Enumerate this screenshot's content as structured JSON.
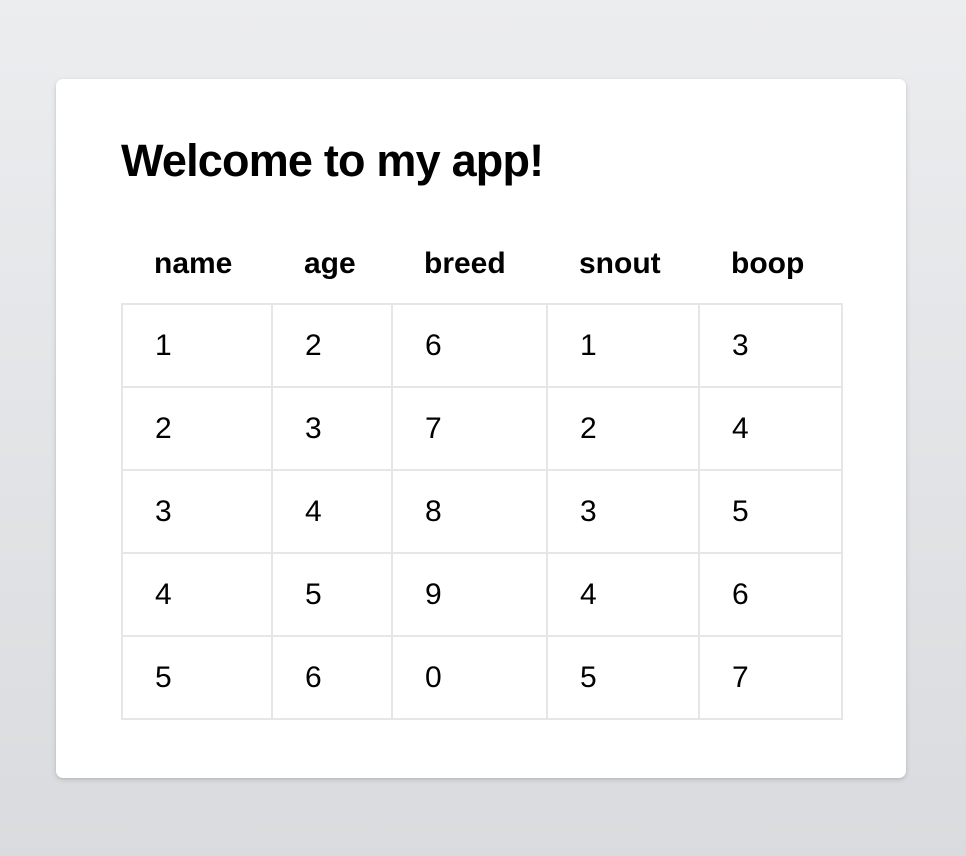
{
  "page": {
    "title": "Welcome to my app!"
  },
  "table": {
    "columns": [
      "name",
      "age",
      "breed",
      "snout",
      "boop"
    ],
    "rows": [
      [
        "1",
        "2",
        "6",
        "1",
        "3"
      ],
      [
        "2",
        "3",
        "7",
        "2",
        "4"
      ],
      [
        "3",
        "4",
        "8",
        "3",
        "5"
      ],
      [
        "4",
        "5",
        "9",
        "4",
        "6"
      ],
      [
        "5",
        "6",
        "0",
        "5",
        "7"
      ]
    ]
  },
  "colors": {
    "background_top": "#ecedef",
    "background_bottom": "#d9dbde",
    "card": "#ffffff",
    "cell_border": "#e6e6e6",
    "text": "#000000"
  }
}
